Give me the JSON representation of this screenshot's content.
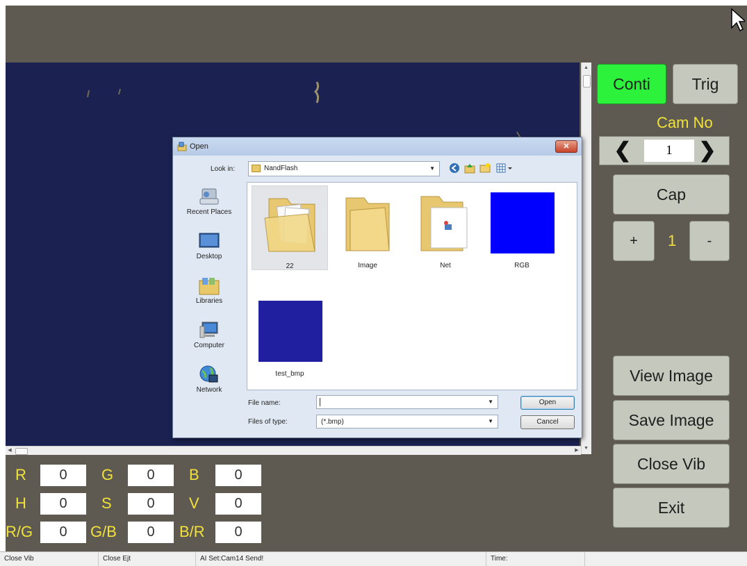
{
  "buttons": {
    "conti": "Conti",
    "trig": "Trig",
    "cap": "Cap",
    "plus": "+",
    "minus": "-",
    "view_image": "View Image",
    "save_image": "Save Image",
    "close_vib": "Close Vib",
    "exit": "Exit"
  },
  "camera": {
    "label": "Cam No",
    "number": "1",
    "prev": "❮",
    "next": "❯"
  },
  "capture_count": "1",
  "readouts": [
    {
      "label": "R",
      "value": "0"
    },
    {
      "label": "G",
      "value": "0"
    },
    {
      "label": "B",
      "value": "0"
    },
    {
      "label": "H",
      "value": "0"
    },
    {
      "label": "S",
      "value": "0"
    },
    {
      "label": "V",
      "value": "0"
    },
    {
      "label": "R/G",
      "value": "0"
    },
    {
      "label": "G/B",
      "value": "0"
    },
    {
      "label": "B/R",
      "value": "0"
    }
  ],
  "status": [
    "Close Vib",
    "Close Ejt",
    "AI Set:Cam14  Send!",
    "Time:"
  ],
  "dialog": {
    "title": "Open",
    "close": "✕",
    "look_in_label": "Look in:",
    "look_in_value": "NandFlash",
    "places": [
      "Recent Places",
      "Desktop",
      "Libraries",
      "Computer",
      "Network"
    ],
    "files": [
      {
        "name": "22",
        "kind": "folder-docs",
        "selected": true
      },
      {
        "name": "Image",
        "kind": "folder"
      },
      {
        "name": "Net",
        "kind": "folder-net"
      },
      {
        "name": "RGB",
        "kind": "image",
        "color": "#0000ff"
      },
      {
        "name": "test_bmp",
        "kind": "image",
        "color": "#1f1fa0"
      }
    ],
    "file_name_label": "File name:",
    "file_name_value": "",
    "files_of_type_label": "Files of type:",
    "files_of_type_value": "(*.bmp)",
    "open_button": "Open",
    "cancel_button": "Cancel"
  },
  "colors": {
    "background": "#5e5a52",
    "viewport": "#1b2150",
    "accent_label": "#f1e13b",
    "active_button": "#2cf23b",
    "button": "#c5c8bd"
  }
}
